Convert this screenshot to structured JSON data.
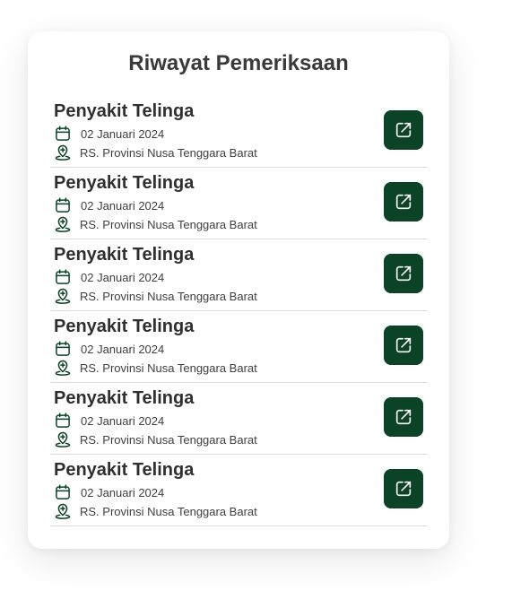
{
  "title": "Riwayat Pemeriksaan",
  "colors": {
    "accent": "#0b4326",
    "icon": "#0b4326"
  },
  "records": [
    {
      "disease": "Penyakit Telinga",
      "date": "02 Januari 2024",
      "hospital": "RS. Provinsi Nusa Tenggara Barat",
      "date_icon": "calendar-icon",
      "place_icon": "location-pin-icon",
      "action_icon": "external-link-icon"
    },
    {
      "disease": "Penyakit Telinga",
      "date": "02 Januari 2024",
      "hospital": "RS. Provinsi Nusa Tenggara Barat",
      "date_icon": "calendar-icon",
      "place_icon": "location-pin-icon",
      "action_icon": "external-link-icon"
    },
    {
      "disease": "Penyakit Telinga",
      "date": "02 Januari 2024",
      "hospital": "RS. Provinsi Nusa Tenggara Barat",
      "date_icon": "calendar-icon",
      "place_icon": "location-pin-icon",
      "action_icon": "external-link-icon"
    },
    {
      "disease": "Penyakit Telinga",
      "date": "02 Januari 2024",
      "hospital": "RS. Provinsi Nusa Tenggara Barat",
      "date_icon": "calendar-icon",
      "place_icon": "location-pin-icon",
      "action_icon": "external-link-icon"
    },
    {
      "disease": "Penyakit Telinga",
      "date": "02 Januari 2024",
      "hospital": "RS. Provinsi Nusa Tenggara Barat",
      "date_icon": "calendar-icon",
      "place_icon": "location-pin-icon",
      "action_icon": "external-link-icon"
    },
    {
      "disease": "Penyakit Telinga",
      "date": "02 Januari 2024",
      "hospital": "RS. Provinsi Nusa Tenggara Barat",
      "date_icon": "calendar-icon",
      "place_icon": "location-pin-icon",
      "action_icon": "external-link-icon"
    }
  ]
}
